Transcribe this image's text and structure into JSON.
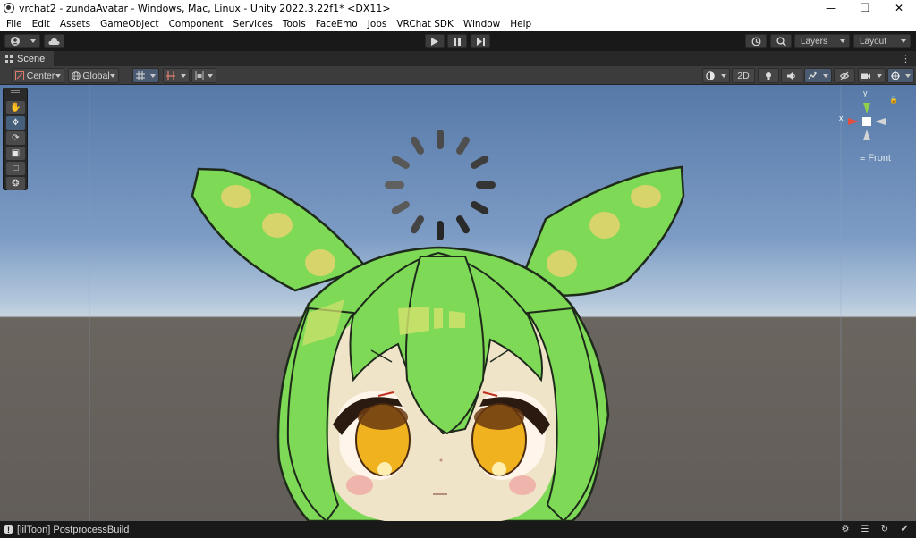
{
  "window": {
    "title": "vrchat2 - zundaAvatar - Windows, Mac, Linux - Unity 2022.3.22f1* <DX11>",
    "minimize_icon": "minimize-icon",
    "maximize_icon": "restore-icon",
    "close_icon": "close-icon"
  },
  "menu": [
    "File",
    "Edit",
    "Assets",
    "GameObject",
    "Component",
    "Services",
    "Tools",
    "FaceEmo",
    "Jobs",
    "VRChat SDK",
    "Window",
    "Help"
  ],
  "toolbar": {
    "account_icon": "account-icon",
    "cloud_icon": "cloud-icon",
    "play_icon": "play-icon",
    "pause_icon": "pause-icon",
    "step_icon": "step-icon",
    "history_icon": "history-icon",
    "search_icon": "search-icon",
    "layers_label": "Layers",
    "layout_label": "Layout"
  },
  "scene_tab": {
    "label": "Scene"
  },
  "scene_toolbar": {
    "pivot_label": "Center",
    "space_label": "Global",
    "toggle_2d_label": "2D"
  },
  "tools": [
    "hand-tool-icon",
    "move-tool-icon",
    "rotate-tool-icon",
    "scale-tool-icon",
    "rect-tool-icon",
    "transform-tool-icon"
  ],
  "active_tool_index": 1,
  "gizmo": {
    "y_label": "y",
    "x_label": "x",
    "view_label": "Front"
  },
  "status": {
    "message": "[lilToon] PostprocessBuild"
  },
  "colors": {
    "accent": "#46607c",
    "hair_green": "#7ed957",
    "eye_yellow": "#f0b21e"
  }
}
